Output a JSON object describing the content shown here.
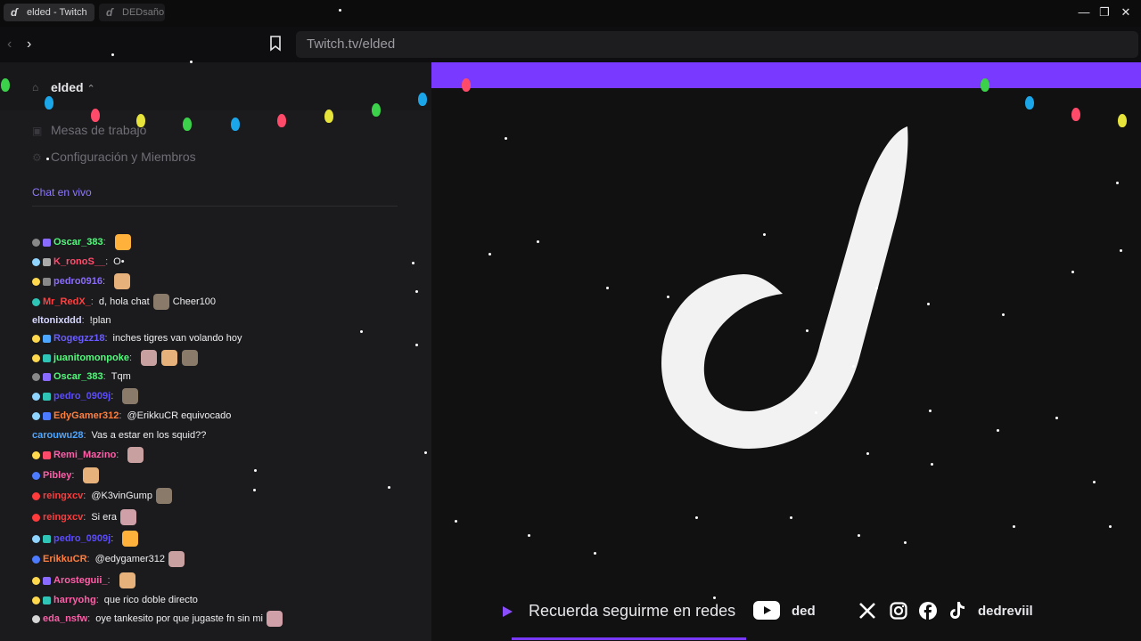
{
  "browser": {
    "tabs": [
      {
        "label": "elded - Twitch",
        "active": true
      },
      {
        "label": "DEDsaño",
        "active": false
      }
    ],
    "url": "Twitch.tv/elded"
  },
  "channel": {
    "name": "elded",
    "nav": [
      {
        "label": "Mesas de trabajo"
      },
      {
        "label": "Configuración y Miembros"
      }
    ],
    "chat_link": "Chat en vivo"
  },
  "chat": [
    {
      "user": "Oscar_383",
      "color": "#50fa7b",
      "text": "",
      "emotes": 1
    },
    {
      "user": "K_ronoS__",
      "color": "#ff4d6d",
      "text": "O•",
      "emotes": 0
    },
    {
      "user": "pedro0916",
      "color": "#8a6bff",
      "text": "",
      "emotes": 1
    },
    {
      "user": "Mr_RedX_",
      "color": "#ff4040",
      "text": "d, hola chat",
      "emotes": 1,
      "suffix": "Cheer100"
    },
    {
      "user": "eltonixddd",
      "color": "#d6d6ff",
      "text": "!plan",
      "emotes": 0
    },
    {
      "user": "Rogegzz18",
      "color": "#6a5cff",
      "text": "inches tigres van volando hoy",
      "emotes": 0
    },
    {
      "user": "juanitomonpoke",
      "color": "#50fa7b",
      "text": "",
      "emotes": 3
    },
    {
      "user": "Oscar_383",
      "color": "#50fa7b",
      "text": "Tqm",
      "emotes": 0
    },
    {
      "user": "pedro_0909j",
      "color": "#5b4bff",
      "text": "",
      "emotes": 1
    },
    {
      "user": "EdyGamer312",
      "color": "#ff7f3f",
      "text": "@ErikkuCR",
      "emotes": 0,
      "suffix": "equivocado"
    },
    {
      "user": "carouwu28",
      "color": "#4da6ff",
      "text": "Vas a estar en los squid??",
      "emotes": 0
    },
    {
      "user": "Remi_Mazino",
      "color": "#ff5ea8",
      "text": "",
      "emotes": 1
    },
    {
      "user": "Pibley",
      "color": "#ff5ea8",
      "text": "",
      "emotes": 1
    },
    {
      "user": "reingxcv",
      "color": "#ff3b3b",
      "text": "@K3vinGump",
      "emotes": 1
    },
    {
      "user": "reingxcv",
      "color": "#ff3b3b",
      "text": "Si era",
      "emotes": 1
    },
    {
      "user": "pedro_0909j",
      "color": "#5b4bff",
      "text": "",
      "emotes": 1
    },
    {
      "user": "ErikkuCR",
      "color": "#ff7f3f",
      "text": "@edygamer312",
      "emotes": 1
    },
    {
      "user": "Arosteguii_",
      "color": "#ff5ea8",
      "text": "",
      "emotes": 1
    },
    {
      "user": "harryohg",
      "color": "#ff5ea8",
      "text": "que rico doble directo",
      "emotes": 0
    },
    {
      "user": "eda_nsfw",
      "color": "#ff5ea8",
      "text": "oye tankesito por que jugaste fn sin mi",
      "emotes": 1
    }
  ],
  "stream": {
    "footer_text": "Recuerda seguirme en redes",
    "youtube_handle": "ded",
    "social_handle": "dedreviil",
    "progress": 0.33
  },
  "colors": {
    "accent": "#7a39ff",
    "panel": "#1b1b1e",
    "stage": "#111112"
  },
  "icons": [
    "back-icon",
    "forward-icon",
    "bookmark-icon",
    "home-icon",
    "play-icon",
    "youtube-icon",
    "x-icon",
    "instagram-icon",
    "facebook-icon",
    "tiktok-icon"
  ]
}
